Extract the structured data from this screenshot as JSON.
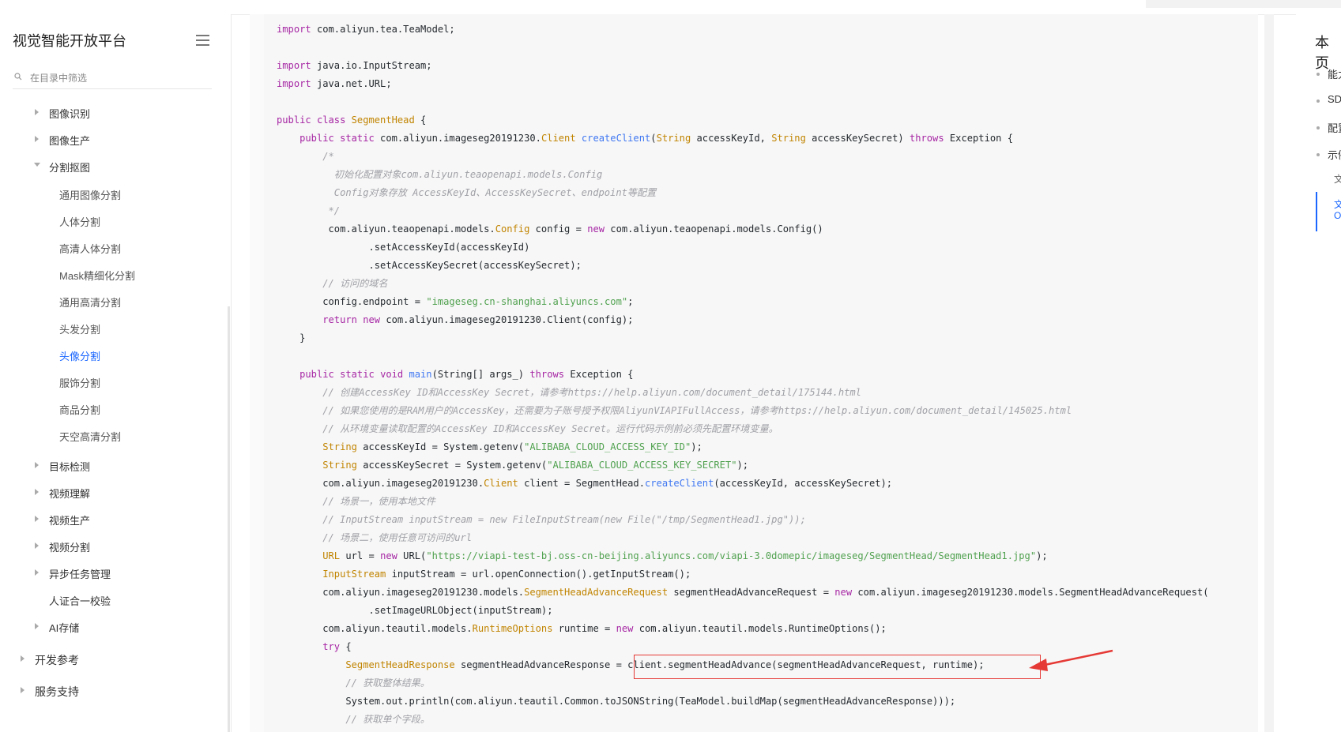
{
  "sidebar": {
    "title": "视觉智能开放平台",
    "search_placeholder": "在目录中筛选",
    "items": [
      {
        "label": "图像识别"
      },
      {
        "label": "图像生产"
      },
      {
        "label": "分割抠图"
      },
      {
        "label": "通用图像分割"
      },
      {
        "label": "人体分割"
      },
      {
        "label": "高清人体分割"
      },
      {
        "label": "Mask精细化分割"
      },
      {
        "label": "通用高清分割"
      },
      {
        "label": "头发分割"
      },
      {
        "label": "头像分割"
      },
      {
        "label": "服饰分割"
      },
      {
        "label": "商品分割"
      },
      {
        "label": "天空高清分割"
      },
      {
        "label": "目标检测"
      },
      {
        "label": "视频理解"
      },
      {
        "label": "视频生产"
      },
      {
        "label": "视频分割"
      },
      {
        "label": "异步任务管理"
      },
      {
        "label": "人证合一校验"
      },
      {
        "label": "AI存储"
      },
      {
        "label": "开发参考"
      },
      {
        "label": "服务支持"
      }
    ],
    "active_item": "头像分割"
  },
  "code": {
    "language": "java",
    "lines": [
      "import com.aliyun.tea.TeaModel;",
      "",
      "import java.io.InputStream;",
      "import java.net.URL;",
      "",
      "public class SegmentHead {",
      "    public static com.aliyun.imageseg20191230.Client createClient(String accessKeyId, String accessKeySecret) throws Exception {",
      "        /*",
      "          初始化配置对象com.aliyun.teaopenapi.models.Config",
      "          Config对象存放 AccessKeyId、AccessKeySecret、endpoint等配置",
      "         */",
      "         com.aliyun.teaopenapi.models.Config config = new com.aliyun.teaopenapi.models.Config()",
      "                .setAccessKeyId(accessKeyId)",
      "                .setAccessKeySecret(accessKeySecret);",
      "        // 访问的域名",
      "        config.endpoint = \"imageseg.cn-shanghai.aliyuncs.com\";",
      "        return new com.aliyun.imageseg20191230.Client(config);",
      "    }",
      "",
      "    public static void main(String[] args_) throws Exception {",
      "        // 创建AccessKey ID和AccessKey Secret，请参考https://help.aliyun.com/document_detail/175144.html",
      "        // 如果您使用的是RAM用户的AccessKey，还需要为子账号授予权限AliyunVIAPIFullAccess，请参考https://help.aliyun.com/document_detail/145025.html",
      "        // 从环境变量读取配置的AccessKey ID和AccessKey Secret。运行代码示例前必须先配置环境变量。",
      "        String accessKeyId = System.getenv(\"ALIBABA_CLOUD_ACCESS_KEY_ID\");",
      "        String accessKeySecret = System.getenv(\"ALIBABA_CLOUD_ACCESS_KEY_SECRET\");",
      "        com.aliyun.imageseg20191230.Client client = SegmentHead.createClient(accessKeyId, accessKeySecret);",
      "        // 场景一，使用本地文件",
      "        // InputStream inputStream = new FileInputStream(new File(\"/tmp/SegmentHead1.jpg\"));",
      "        // 场景二，使用任意可访问的url",
      "        URL url = new URL(\"https://viapi-test-bj.oss-cn-beijing.aliyuncs.com/viapi-3.0domepic/imageseg/SegmentHead/SegmentHead1.jpg\");",
      "        InputStream inputStream = url.openConnection().getInputStream();",
      "        com.aliyun.imageseg20191230.models.SegmentHeadAdvanceRequest segmentHeadAdvanceRequest = new com.aliyun.imageseg20191230.models.SegmentHeadAdvanceRequest(",
      "                .setImageURLObject(inputStream);",
      "        com.aliyun.teautil.models.RuntimeOptions runtime = new com.aliyun.teautil.models.RuntimeOptions();",
      "        try {",
      "            SegmentHeadResponse segmentHeadAdvanceResponse = client.segmentHeadAdvance(segmentHeadAdvanceRequest, runtime);",
      "            // 获取整体结果。",
      "            System.out.println(com.aliyun.teautil.Common.toJSONString(TeaModel.buildMap(segmentHeadAdvanceResponse)));",
      "            // 获取单个字段。"
    ]
  },
  "toc": {
    "title": "本页",
    "items": [
      "能力",
      "SD",
      "配置",
      "示例"
    ],
    "sub_items": [
      "文",
      "文",
      "O"
    ]
  },
  "annotation": {
    "highlight_color": "#e53935"
  }
}
